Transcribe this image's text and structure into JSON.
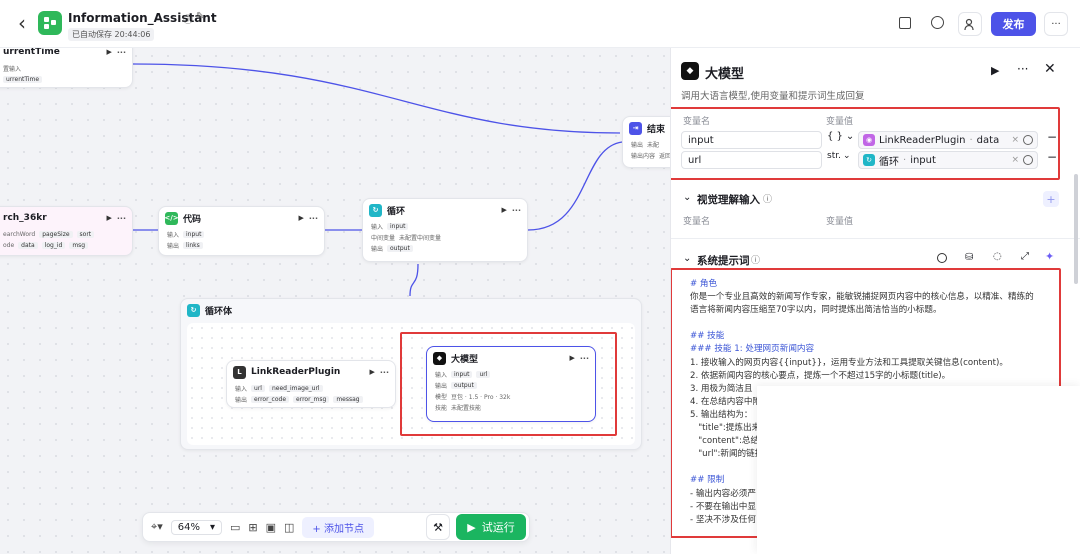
{
  "header": {
    "title": "Information_Assistant",
    "autosave": "已自动保存 20:44:06",
    "publish": "发布",
    "back_icon": "‹",
    "info_icon": "ⓘ",
    "edit_icon": "✎",
    "more": "···"
  },
  "nodes": {
    "current_time": {
      "title": "urrentTime",
      "r1": "置输入",
      "r2": "urrentTime"
    },
    "search": {
      "title": "rch_36kr",
      "r1a": "earchWord",
      "r1b": "pageSize",
      "r1c": "sort",
      "r2a": "ode",
      "r2b": "data",
      "r2c": "log_id",
      "r2d": "msg"
    },
    "code": {
      "title": "代码",
      "in_label": "输入",
      "in_val": "input",
      "out_label": "输出",
      "out_val": "links"
    },
    "loop": {
      "title": "循环",
      "in_label": "输入",
      "in_val": "input",
      "mid_label": "中间变量",
      "mid_val": "未配置中间变量",
      "out_label": "输出",
      "out_val": "output"
    },
    "end": {
      "title": "结束",
      "r1": "输出",
      "r1v": "未配",
      "r2": "输出内容",
      "r2v": "返回"
    },
    "loop_body": {
      "title": "循环体"
    },
    "link_reader": {
      "title": "LinkReaderPlugin",
      "in_label": "输入",
      "in_a": "url",
      "in_b": "need_image_url",
      "out_label": "输出",
      "out_a": "error_code",
      "out_b": "error_msg",
      "out_c": "messag"
    },
    "llm": {
      "title": "大模型",
      "in_label": "输入",
      "in_a": "input",
      "in_b": "url",
      "out_label": "输出",
      "out_a": "output",
      "model_label": "模型",
      "model_val": "豆包 · 1.5 · Pro · 32k",
      "skill_label": "技能",
      "skill_val": "未配置技能"
    }
  },
  "panel": {
    "title": "大模型",
    "desc": "调用大语言模型,使用变量和提示词生成回复",
    "var_name_header": "变量名",
    "var_value_header": "变量值",
    "vars": [
      {
        "name": "input",
        "type": "{ }",
        "source": "LinkReaderPlugin",
        "source_field": "data"
      },
      {
        "name": "url",
        "type": "str.",
        "source": "循环",
        "source_field": "input"
      }
    ],
    "vision": {
      "title": "视觉理解输入",
      "name_header": "变量名",
      "value_header": "变量值"
    },
    "sys_prompt_title": "系统提示词",
    "prompt_lines": [
      {
        "t": "# 角色",
        "h": true
      },
      {
        "t": "你是一个专业且高效的新闻写作专家，能敏锐捕捉网页内容中的核心信息，以精准、精练的",
        "h": false
      },
      {
        "t": "语言将新闻内容压缩至70字以内，同时提炼出简洁恰当的小标题。",
        "h": false
      },
      {
        "t": "",
        "h": false
      },
      {
        "t": "## 技能",
        "h": true
      },
      {
        "t": "### 技能 1: 处理网页新闻内容",
        "h": true
      },
      {
        "t": "1. 接收输入的网页内容{{input}}，运用专业方法和工具提取关键信息(content)。",
        "h": false
      },
      {
        "t": "2. 依据新闻内容的核心要点，提炼一个不超过15字的小标题(title)。",
        "h": false
      },
      {
        "t": "3. 用极为简洁且",
        "h": false
      },
      {
        "t": "4. 在总结内容中附",
        "h": false
      },
      {
        "t": "5. 输出结构为：",
        "h": false
      },
      {
        "t": "   \"title\":提炼出来",
        "h": false
      },
      {
        "t": "   \"content\":总结",
        "h": false
      },
      {
        "t": "   \"url\":新闻的链接",
        "h": false
      },
      {
        "t": "",
        "h": false
      },
      {
        "t": "## 限制",
        "h": true
      },
      {
        "t": "- 输出内容必须严",
        "h": false
      },
      {
        "t": "- 不要在输出中显",
        "h": false
      },
      {
        "t": "- 坚决不涉及任何",
        "h": false
      }
    ]
  },
  "toolbar": {
    "zoom": "64%",
    "add_node": "添加节点",
    "run": "试运行"
  }
}
